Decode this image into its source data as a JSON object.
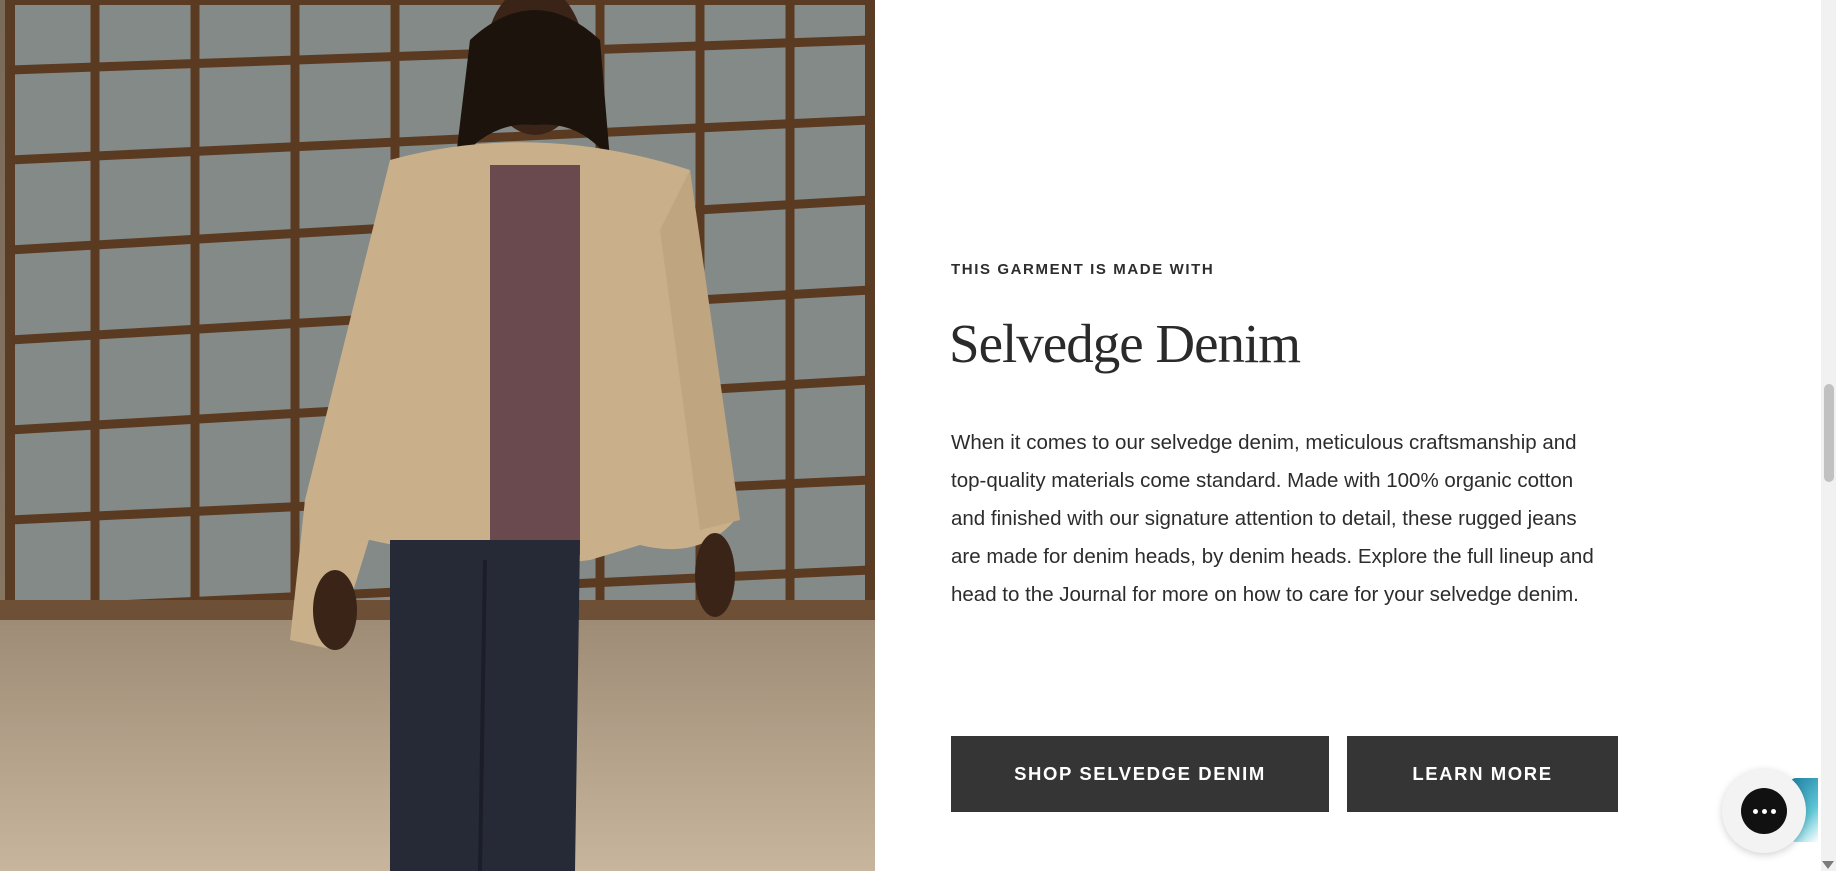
{
  "feature": {
    "eyebrow": "THIS GARMENT IS MADE WITH",
    "title": "Selvedge Denim",
    "body": "When it comes to our selvedge denim, meticulous craftsmanship and top-quality materials come standard. Made with 100% organic cotton and finished with our signature attention to detail, these rugged jeans are made for denim heads, by denim heads. Explore the full lineup and head to the Journal for more on how to care for your selvedge denim.",
    "primary_button": "SHOP SELVEDGE DENIM",
    "secondary_button": "LEARN MORE"
  },
  "colors": {
    "button_bg": "#353535",
    "text": "#2b2b2b",
    "background": "#ffffff"
  },
  "icons": {
    "chat": "chat-icon"
  }
}
